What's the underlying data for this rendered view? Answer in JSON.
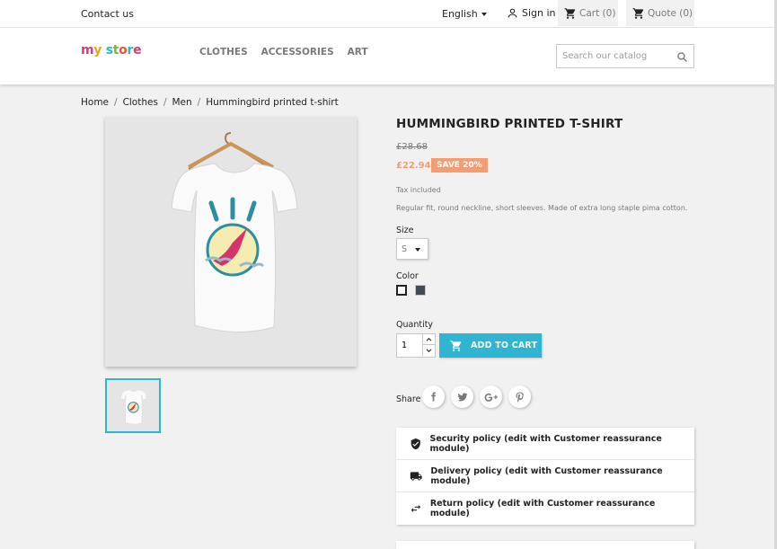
{
  "topbar": {
    "contact_label": "Contact us",
    "language_label": "English",
    "signin_label": "Sign in",
    "cart_label": "Cart (0)",
    "quote_label": "Quote (0)"
  },
  "header": {
    "logo": {
      "m": "m",
      "y": "y",
      "space": " ",
      "s": "s",
      "t": "t",
      "o": "o",
      "r": "r",
      "e": "e"
    },
    "nav": [
      "CLOTHES",
      "ACCESSORIES",
      "ART"
    ],
    "search_placeholder": "Search our catalog"
  },
  "breadcrumb": [
    "Home",
    "Clothes",
    "Men",
    "Hummingbird printed t-shirt"
  ],
  "product": {
    "title": "HUMMINGBIRD PRINTED T-SHIRT",
    "old_price": "£28.68",
    "price": "£22.94",
    "discount_label": "SAVE 20%",
    "tax_note": "Tax included",
    "description": "Regular fit, round neckline, short sleeves. Made of extra long staple pima cotton.",
    "size_label": "Size",
    "size_value": "S",
    "color_label": "Color",
    "colors": [
      "#ffffff",
      "#434a54"
    ],
    "quantity_label": "Quantity",
    "quantity_value": "1",
    "add_to_cart_label": "ADD TO CART",
    "share_label": "Share"
  },
  "reassurance": [
    {
      "icon": "shield-check-icon",
      "label": "Security policy (edit with Customer reassurance module)"
    },
    {
      "icon": "truck-icon",
      "label": "Delivery policy (edit with Customer reassurance module)"
    },
    {
      "icon": "swap-arrows-icon",
      "label": "Return policy (edit with Customer reassurance module)"
    }
  ],
  "colors": {
    "accent": "#2fb5d2",
    "discount": "#f39d72",
    "background": "#f1f1f1"
  }
}
